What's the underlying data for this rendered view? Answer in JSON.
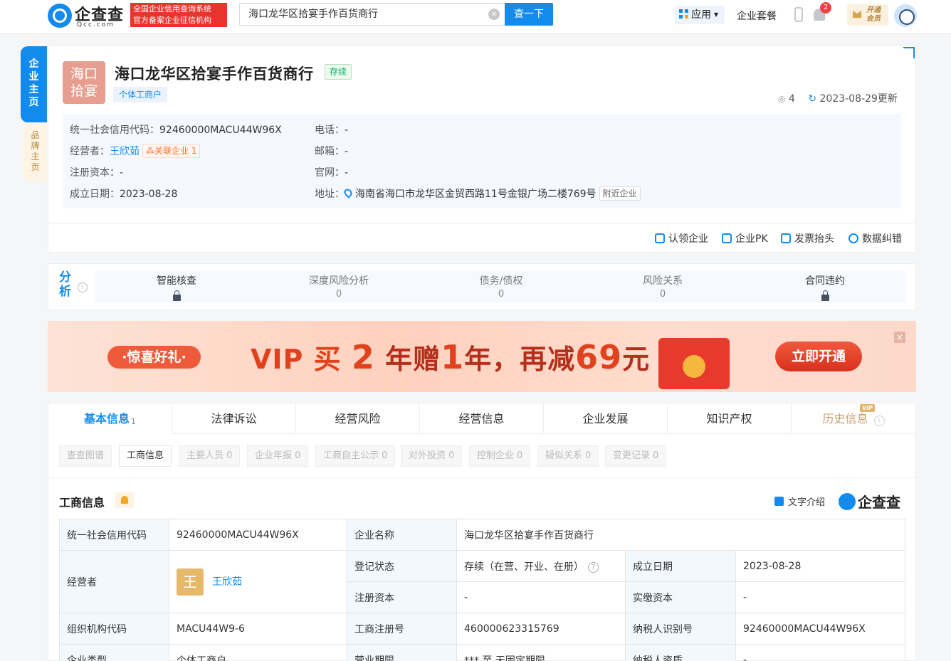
{
  "header": {
    "logo_text": "企查查",
    "logo_sub": "Qcc.com",
    "slogan_line1": "全国企业信用查询系统",
    "slogan_line2": "官方备案企业征信机构",
    "search_value": "海口龙华区拾宴手作百货商行",
    "search_button": "查一下",
    "apps_label": "应用",
    "combo_label": "企业套餐",
    "notification_count": "2",
    "vip_open_line1": "开通",
    "vip_open_line2": "会员"
  },
  "sidenav": {
    "company_home": "企业主页",
    "brand_home": "品牌主页"
  },
  "company": {
    "logo_line1": "海口",
    "logo_line2": "拾宴",
    "name": "海口龙华区拾宴手作百货商行",
    "status": "存续",
    "type_tag": "个体工商户",
    "follow_count": "4",
    "update_text": "2023-08-29更新",
    "credit_code_label": "统一社会信用代码：",
    "credit_code": "92460000MACU44W96X",
    "operator_label": "经营者：",
    "operator": "王欣茹",
    "related_label": "关联企业",
    "related_count": "1",
    "capital_label": "注册资本：",
    "capital": "-",
    "founded_label": "成立日期：",
    "founded": "2023-08-28",
    "phone_label": "电话：",
    "phone": "-",
    "email_label": "邮箱：",
    "email": "-",
    "website_label": "官网：",
    "website": "-",
    "address_label": "地址：",
    "address": "海南省海口市龙华区金贸西路11号金银广场二楼769号",
    "nearby_label": "附近企业"
  },
  "actions": [
    "认领企业",
    "企业PK",
    "发票抬头",
    "数据纠错"
  ],
  "analysis": {
    "title": "分析",
    "items": [
      {
        "label": "智能核查",
        "value": ""
      },
      {
        "label": "深度风险分析",
        "value": "0"
      },
      {
        "label": "债务/债权",
        "value": "0"
      },
      {
        "label": "风险关系",
        "value": "0"
      },
      {
        "label": "合同违约",
        "value": ""
      }
    ]
  },
  "banner": {
    "gift": "·惊喜好礼·",
    "text_a": "VIP 买 ",
    "num_a": "2",
    "text_b": " 年赠",
    "num_b": "1",
    "text_c": "年，再减",
    "num_c": "69",
    "text_d": "元",
    "button": "立即开通",
    "close": "×"
  },
  "tabs": [
    {
      "label": "基本信息",
      "count": "1"
    },
    {
      "label": "法律诉讼"
    },
    {
      "label": "经营风险"
    },
    {
      "label": "经营信息"
    },
    {
      "label": "企业发展"
    },
    {
      "label": "知识产权"
    },
    {
      "label": "历史信息",
      "badge": "VIP"
    }
  ],
  "subtabs": [
    "查查图谱",
    "工商信息",
    "主要人员 0",
    "企业年报 0",
    "工商自主公示 0",
    "对外投资 0",
    "控制企业 0",
    "疑似关系 0",
    "变更记录 0"
  ],
  "section": {
    "title": "工商信息",
    "text_intro": "文字介绍",
    "watermark": "企查查"
  },
  "table": {
    "credit_code_label": "统一社会信用代码",
    "credit_code": "92460000MACU44W96X",
    "name_label": "企业名称",
    "name": "海口龙华区拾宴手作百货商行",
    "operator_label": "经营者",
    "operator_avatar": "王",
    "operator": "王欣茹",
    "reg_status_label": "登记状态",
    "reg_status": "存续（在营、开业、在册）",
    "founded_label": "成立日期",
    "founded": "2023-08-28",
    "capital_label": "注册资本",
    "capital": "-",
    "paid_capital_label": "实缴资本",
    "paid_capital": "-",
    "org_code_label": "组织机构代码",
    "org_code": "MACU44W9-6",
    "biz_reg_label": "工商注册号",
    "biz_reg": "460000623315769",
    "tax_id_label": "纳税人识别号",
    "tax_id": "92460000MACU44W96X",
    "ent_type_label": "企业类型",
    "ent_type": "个体工商户",
    "term_label": "营业期限",
    "term": "*** 至 无固定期限",
    "taxpayer_label": "纳税人资质",
    "taxpayer": "-"
  }
}
